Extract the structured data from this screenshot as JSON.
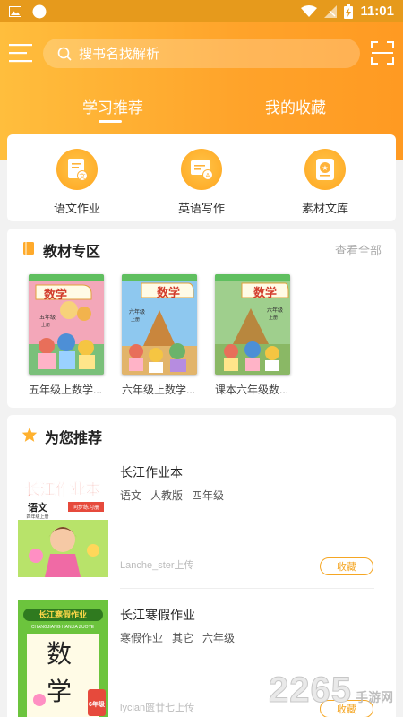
{
  "status_bar": {
    "time": "11:01"
  },
  "search": {
    "placeholder": "搜书名找解析"
  },
  "tabs": [
    {
      "label": "学习推荐"
    },
    {
      "label": "我的收藏"
    }
  ],
  "quick_actions": [
    {
      "label": "语文作业",
      "icon": "chinese-homework-icon",
      "glyph": "文"
    },
    {
      "label": "英语写作",
      "icon": "english-writing-icon",
      "glyph": "A"
    },
    {
      "label": "素材文库",
      "icon": "material-library-icon",
      "glyph": "★"
    }
  ],
  "textbooks": {
    "title": "教材专区",
    "view_all": "查看全部",
    "books": [
      {
        "title": "五年级上数学...",
        "cover_title": "数学",
        "grade": "五年级",
        "term": "上册",
        "bg": "#f3a7b9"
      },
      {
        "title": "六年级上数学...",
        "cover_title": "数学",
        "grade": "六年级",
        "term": "上册",
        "bg": "#8ec8ef"
      },
      {
        "title": "课本六年级数...",
        "cover_title": "数学",
        "grade": "六年级",
        "term": "上册",
        "bg": "#9fcf8d"
      }
    ]
  },
  "recommend": {
    "title": "为您推荐",
    "items": [
      {
        "title": "长江作业本",
        "tags": [
          "语文",
          "人教版",
          "四年级"
        ],
        "uploader": "Lanche_ster上传",
        "button": "收藏",
        "cover": {
          "headline": "长江作业本",
          "subject": "语文",
          "series": "同步练习册",
          "grade": "四年级上册"
        }
      },
      {
        "title": "长江寒假作业",
        "tags": [
          "寒假作业",
          "其它",
          "六年级"
        ],
        "uploader": "lycian匮廿七上传",
        "button": "收藏",
        "cover": {
          "headline": "长江寒假作业",
          "pinyin": "CHANGJIANG HANJIA ZUOYE",
          "subject_1": "数",
          "subject_2": "学",
          "grade": "6年级"
        }
      }
    ]
  },
  "watermark": {
    "number": "2265",
    "text": "手游网"
  },
  "colors": {
    "accent": "#ffa32a",
    "favorite": "#f5a623"
  }
}
